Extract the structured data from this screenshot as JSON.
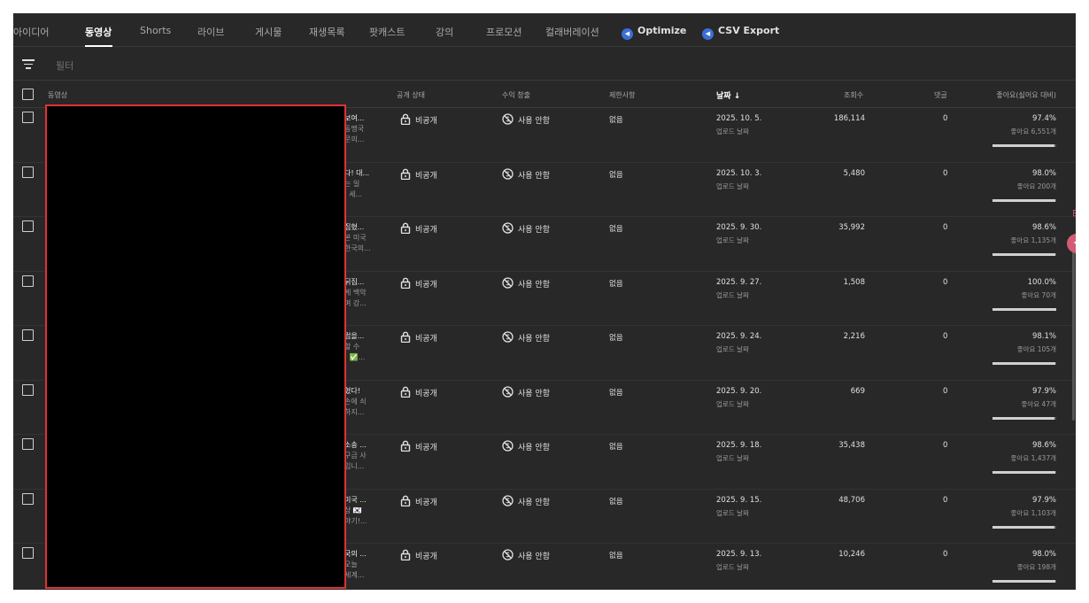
{
  "tabs": [
    {
      "label": "아이디어",
      "active": false
    },
    {
      "label": "동영상",
      "active": true
    },
    {
      "label": "Shorts",
      "active": false
    },
    {
      "label": "라이브",
      "active": false
    },
    {
      "label": "게시물",
      "active": false
    },
    {
      "label": "재생목록",
      "active": false
    },
    {
      "label": "팟캐스트",
      "active": false
    },
    {
      "label": "강의",
      "active": false
    },
    {
      "label": "프로모션",
      "active": false
    },
    {
      "label": "컬래버레이션",
      "active": false
    },
    {
      "label": "Optimize",
      "active": false,
      "icon": "extension-icon"
    },
    {
      "label": "CSV Export",
      "active": false,
      "icon": "extension-icon"
    }
  ],
  "filter": {
    "placeholder": "필터"
  },
  "columns": {
    "video": "동영상",
    "visibility": "공개 상태",
    "monetization": "수익 창출",
    "restrictions": "제한사항",
    "date": "날짜 ↓",
    "views": "조회수",
    "comments": "댓글",
    "likes": "좋아요(싫어요 대비)"
  },
  "rows": [
    {
      "title": [
        "보여...",
        "동맹국",
        "문의..."
      ],
      "visibility": "비공개",
      "monetization": "사용 안함",
      "restrictions": "없음",
      "date": "2025. 10. 5.",
      "date_sub": "업로드 날짜",
      "views": "186,114",
      "comments": "0",
      "likes_pct": "97.4%",
      "likes_sub": "좋아요 6,551개",
      "ratio": 0.974
    },
    {
      "title": [
        "다! 대...",
        "는 일",
        ". 세..."
      ],
      "visibility": "비공개",
      "monetization": "사용 안함",
      "restrictions": "없음",
      "date": "2025. 10. 3.",
      "date_sub": "업로드 날짜",
      "views": "5,480",
      "comments": "0",
      "likes_pct": "98.0%",
      "likes_sub": "좋아요 200개",
      "ratio": 0.98
    },
    {
      "title": [
        "집혔...",
        "본 미국",
        "한국의..."
      ],
      "visibility": "비공개",
      "monetization": "사용 안함",
      "restrictions": "없음",
      "date": "2025. 9. 30.",
      "date_sub": "업로드 날짜",
      "views": "35,992",
      "comments": "0",
      "likes_pct": "98.6%",
      "likes_sub": "좋아요 1,135개",
      "ratio": 0.986
    },
    {
      "title": [
        "뒤집...",
        "게 백악",
        "며 강..."
      ],
      "visibility": "비공개",
      "monetization": "사용 안함",
      "restrictions": "없음",
      "date": "2025. 9. 27.",
      "date_sub": "업로드 날짜",
      "views": "1,508",
      "comments": "0",
      "likes_pct": "100.0%",
      "likes_sub": "좋아요 70개",
      "ratio": 1.0
    },
    {
      "title": [
        "럽을...",
        "할 수",
        "! ✅..."
      ],
      "visibility": "비공개",
      "monetization": "사용 안함",
      "restrictions": "없음",
      "date": "2025. 9. 24.",
      "date_sub": "업로드 날짜",
      "views": "2,216",
      "comments": "0",
      "likes_pct": "98.1%",
      "likes_sub": "좋아요 105개",
      "ratio": 0.981
    },
    {
      "title": [
        "혔다!",
        "손에 쇠",
        "하지..."
      ],
      "visibility": "비공개",
      "monetization": "사용 안함",
      "restrictions": "없음",
      "date": "2025. 9. 20.",
      "date_sub": "업로드 날짜",
      "views": "669",
      "comments": "0",
      "likes_pct": "97.9%",
      "likes_sub": "좋아요 47개",
      "ratio": 0.979
    },
    {
      "title": [
        "소송 ...",
        "구금 사",
        "입니..."
      ],
      "visibility": "비공개",
      "monetization": "사용 안함",
      "restrictions": "없음",
      "date": "2025. 9. 18.",
      "date_sub": "업로드 날짜",
      "views": "35,438",
      "comments": "0",
      "likes_pct": "98.6%",
      "likes_sub": "좋아요 1,437개",
      "ratio": 0.986
    },
    {
      "title": [
        "미국 ...",
        "상 🇰🇷",
        "야기!..."
      ],
      "visibility": "비공개",
      "monetization": "사용 안함",
      "restrictions": "없음",
      "date": "2025. 9. 15.",
      "date_sub": "업로드 날짜",
      "views": "48,706",
      "comments": "0",
      "likes_pct": "97.9%",
      "likes_sub": "좋아요 1,103개",
      "ratio": 0.979
    },
    {
      "title": [
        "국의 ...",
        "오늘",
        "세계..."
      ],
      "visibility": "비공개",
      "monetization": "사용 안함",
      "restrictions": "없음",
      "date": "2025. 9. 13.",
      "date_sub": "업로드 날짜",
      "views": "10,246",
      "comments": "0",
      "likes_pct": "98.0%",
      "likes_sub": "좋아요 198개",
      "ratio": 0.98
    }
  ]
}
